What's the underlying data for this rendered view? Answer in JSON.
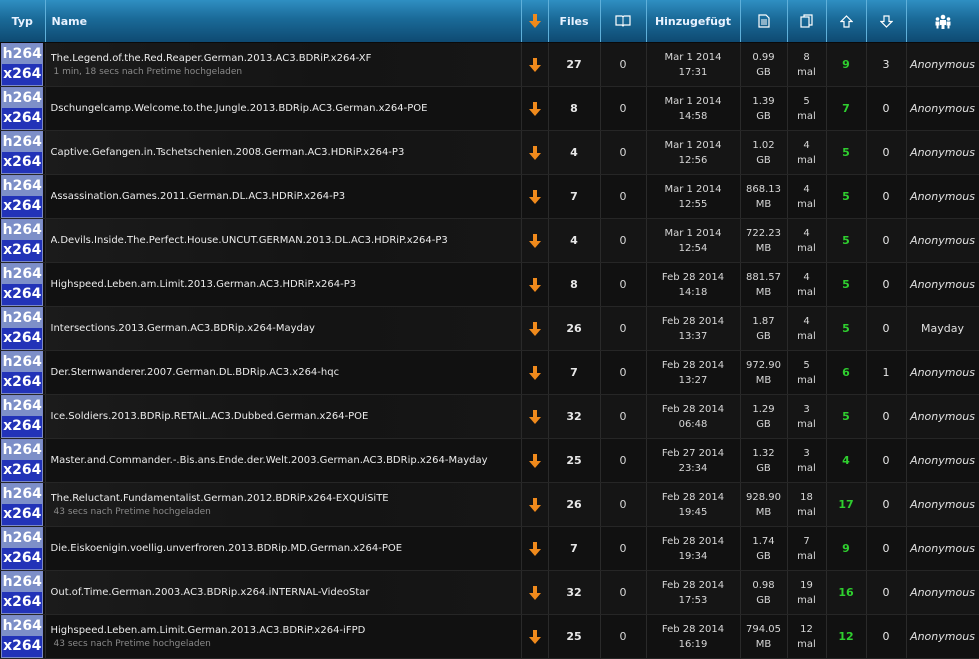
{
  "header": {
    "typ": "Typ",
    "name": "Name",
    "files": "Files",
    "added": "Hinzugefügt"
  },
  "colors": {
    "header_top": "#2f8fc2",
    "header_bottom": "#0e4a72",
    "seeders": "#2fcf2f",
    "download_arrow": "#f08a1c",
    "badge_top": "#7d8fc8",
    "badge_bottom": "#2233b8"
  },
  "icons": [
    "download-arrow-icon",
    "comments-icon",
    "size-icon",
    "snatched-icon",
    "seeders-up-icon",
    "leechers-down-icon",
    "uploader-people-icon"
  ],
  "rows": [
    {
      "badge_top": "h264",
      "badge_bottom": "x264",
      "name": "The.Legend.of.the.Red.Reaper.German.2013.AC3.BDRiP.x264-XF",
      "sub": "1 min, 18 secs nach Pretime hochgeladen",
      "files": "27",
      "comments": "0",
      "date": "Mar 1 2014",
      "time": "17:31",
      "size": "0.99",
      "unit": "GB",
      "snatched": "8",
      "mal": "mal",
      "seeders": "9",
      "leechers": "3",
      "user": "Anonymous"
    },
    {
      "badge_top": "h264",
      "badge_bottom": "x264",
      "name": "Dschungelcamp.Welcome.to.the.Jungle.2013.BDRip.AC3.German.x264-POE",
      "sub": "",
      "files": "8",
      "comments": "0",
      "date": "Mar 1 2014",
      "time": "14:58",
      "size": "1.39",
      "unit": "GB",
      "snatched": "5",
      "mal": "mal",
      "seeders": "7",
      "leechers": "0",
      "user": "Anonymous"
    },
    {
      "badge_top": "h264",
      "badge_bottom": "x264",
      "name": "Captive.Gefangen.in.Tschetschenien.2008.German.AC3.HDRiP.x264-P3",
      "sub": "",
      "files": "4",
      "comments": "0",
      "date": "Mar 1 2014",
      "time": "12:56",
      "size": "1.02",
      "unit": "GB",
      "snatched": "4",
      "mal": "mal",
      "seeders": "5",
      "leechers": "0",
      "user": "Anonymous"
    },
    {
      "badge_top": "h264",
      "badge_bottom": "x264",
      "name": "Assassination.Games.2011.German.DL.AC3.HDRiP.x264-P3",
      "sub": "",
      "files": "7",
      "comments": "0",
      "date": "Mar 1 2014",
      "time": "12:55",
      "size": "868.13",
      "unit": "MB",
      "snatched": "4",
      "mal": "mal",
      "seeders": "5",
      "leechers": "0",
      "user": "Anonymous"
    },
    {
      "badge_top": "h264",
      "badge_bottom": "x264",
      "name": "A.Devils.Inside.The.Perfect.House.UNCUT.GERMAN.2013.DL.AC3.HDRiP.x264-P3",
      "sub": "",
      "files": "4",
      "comments": "0",
      "date": "Mar 1 2014",
      "time": "12:54",
      "size": "722.23",
      "unit": "MB",
      "snatched": "4",
      "mal": "mal",
      "seeders": "5",
      "leechers": "0",
      "user": "Anonymous"
    },
    {
      "badge_top": "h264",
      "badge_bottom": "x264",
      "name": "Highspeed.Leben.am.Limit.2013.German.AC3.HDRiP.x264-P3",
      "sub": "",
      "files": "8",
      "comments": "0",
      "date": "Feb 28 2014",
      "time": "14:18",
      "size": "881.57",
      "unit": "MB",
      "snatched": "4",
      "mal": "mal",
      "seeders": "5",
      "leechers": "0",
      "user": "Anonymous"
    },
    {
      "badge_top": "h264",
      "badge_bottom": "x264",
      "name": "Intersections.2013.German.AC3.BDRip.x264-Mayday",
      "sub": "",
      "files": "26",
      "comments": "0",
      "date": "Feb 28 2014",
      "time": "13:37",
      "size": "1.87",
      "unit": "GB",
      "snatched": "4",
      "mal": "mal",
      "seeders": "5",
      "leechers": "0",
      "user": "Mayday"
    },
    {
      "badge_top": "h264",
      "badge_bottom": "x264",
      "name": "Der.Sternwanderer.2007.German.DL.BDRip.AC3.x264-hqc",
      "sub": "",
      "files": "7",
      "comments": "0",
      "date": "Feb 28 2014",
      "time": "13:27",
      "size": "972.90",
      "unit": "MB",
      "snatched": "5",
      "mal": "mal",
      "seeders": "6",
      "leechers": "1",
      "user": "Anonymous"
    },
    {
      "badge_top": "h264",
      "badge_bottom": "x264",
      "name": "Ice.Soldiers.2013.BDRip.RETAiL.AC3.Dubbed.German.x264-POE",
      "sub": "",
      "files": "32",
      "comments": "0",
      "date": "Feb 28 2014",
      "time": "06:48",
      "size": "1.29",
      "unit": "GB",
      "snatched": "3",
      "mal": "mal",
      "seeders": "5",
      "leechers": "0",
      "user": "Anonymous"
    },
    {
      "badge_top": "h264",
      "badge_bottom": "x264",
      "name": "Master.and.Commander.-.Bis.ans.Ende.der.Welt.2003.German.AC3.BDRip.x264-Mayday",
      "sub": "",
      "files": "25",
      "comments": "0",
      "date": "Feb 27 2014",
      "time": "23:34",
      "size": "1.32",
      "unit": "GB",
      "snatched": "3",
      "mal": "mal",
      "seeders": "4",
      "leechers": "0",
      "user": "Anonymous"
    },
    {
      "badge_top": "h264",
      "badge_bottom": "x264",
      "name": "The.Reluctant.Fundamentalist.German.2012.BDRiP.x264-EXQUiSiTE",
      "sub": "43 secs nach Pretime hochgeladen",
      "files": "26",
      "comments": "0",
      "date": "Feb 28 2014",
      "time": "19:45",
      "size": "928.90",
      "unit": "MB",
      "snatched": "18",
      "mal": "mal",
      "seeders": "17",
      "leechers": "0",
      "user": "Anonymous"
    },
    {
      "badge_top": "h264",
      "badge_bottom": "x264",
      "name": "Die.Eiskoenigin.voellig.unverfroren.2013.BDRip.MD.German.x264-POE",
      "sub": "",
      "files": "7",
      "comments": "0",
      "date": "Feb 28 2014",
      "time": "19:34",
      "size": "1.74",
      "unit": "GB",
      "snatched": "7",
      "mal": "mal",
      "seeders": "9",
      "leechers": "0",
      "user": "Anonymous"
    },
    {
      "badge_top": "h264",
      "badge_bottom": "x264",
      "name": "Out.of.Time.German.2003.AC3.BDRip.x264.iNTERNAL-VideoStar",
      "sub": "",
      "files": "32",
      "comments": "0",
      "date": "Feb 28 2014",
      "time": "17:53",
      "size": "0.98",
      "unit": "GB",
      "snatched": "19",
      "mal": "mal",
      "seeders": "16",
      "leechers": "0",
      "user": "Anonymous"
    },
    {
      "badge_top": "h264",
      "badge_bottom": "x264",
      "name": "Highspeed.Leben.am.Limit.German.2013.AC3.BDRiP.x264-iFPD",
      "sub": "43 secs nach Pretime hochgeladen",
      "files": "25",
      "comments": "0",
      "date": "Feb 28 2014",
      "time": "16:19",
      "size": "794.05",
      "unit": "MB",
      "snatched": "12",
      "mal": "mal",
      "seeders": "12",
      "leechers": "0",
      "user": "Anonymous"
    }
  ]
}
